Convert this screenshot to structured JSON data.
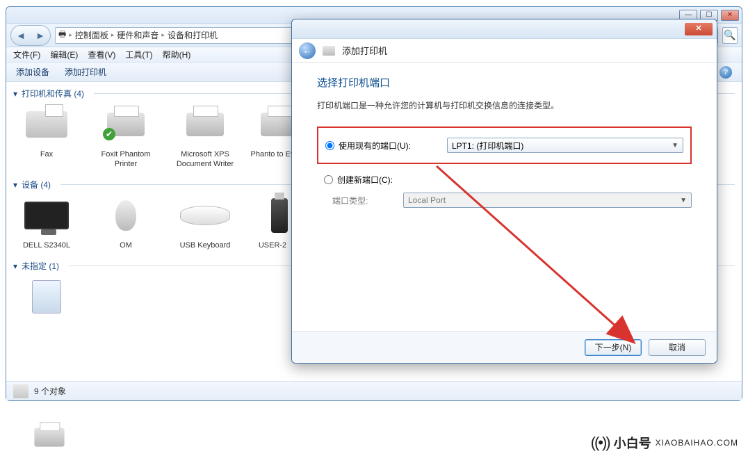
{
  "window": {
    "controls": {
      "min": "—",
      "max": "☐",
      "close": "✕"
    },
    "breadcrumb": {
      "root_icon": "🖶",
      "items": [
        "控制面板",
        "硬件和声音",
        "设备和打印机"
      ]
    },
    "menubar": [
      "文件(F)",
      "编辑(E)",
      "查看(V)",
      "工具(T)",
      "帮助(H)"
    ],
    "toolbar": {
      "add_device": "添加设备",
      "add_printer": "添加打印机"
    }
  },
  "groups": {
    "printers": {
      "label": "打印机和传真 (4)",
      "items": [
        {
          "name": "Fax",
          "type": "fax"
        },
        {
          "name": "Foxit Phantom Printer",
          "type": "printer",
          "default": true
        },
        {
          "name": "Microsoft XPS Document Writer",
          "type": "printer"
        },
        {
          "name": "Phanto to Ev",
          "type": "printer"
        }
      ]
    },
    "devices": {
      "label": "设备 (4)",
      "items": [
        {
          "name": "DELL S2340L",
          "type": "monitor"
        },
        {
          "name": "OM",
          "type": "mouse"
        },
        {
          "name": "USB Keyboard",
          "type": "kbd"
        },
        {
          "name": "USER-2",
          "type": "usb"
        }
      ]
    },
    "unspecified": {
      "label": "未指定 (1)",
      "items": [
        {
          "name": "",
          "type": "box"
        }
      ]
    }
  },
  "statusbar": {
    "count": "9 个对象"
  },
  "dialog": {
    "nav_title": "添加打印机",
    "heading": "选择打印机端口",
    "subtitle": "打印机端口是一种允许您的计算机与打印机交换信息的连接类型。",
    "opt_existing": "使用现有的端口(U):",
    "existing_value": "LPT1: (打印机端口)",
    "opt_new": "创建新端口(C):",
    "port_type_label": "端口类型:",
    "port_type_value": "Local Port",
    "next": "下一步(N)",
    "cancel": "取消"
  },
  "brand": {
    "zh": "小白号",
    "en": "XIAOBAIHAO.COM"
  }
}
